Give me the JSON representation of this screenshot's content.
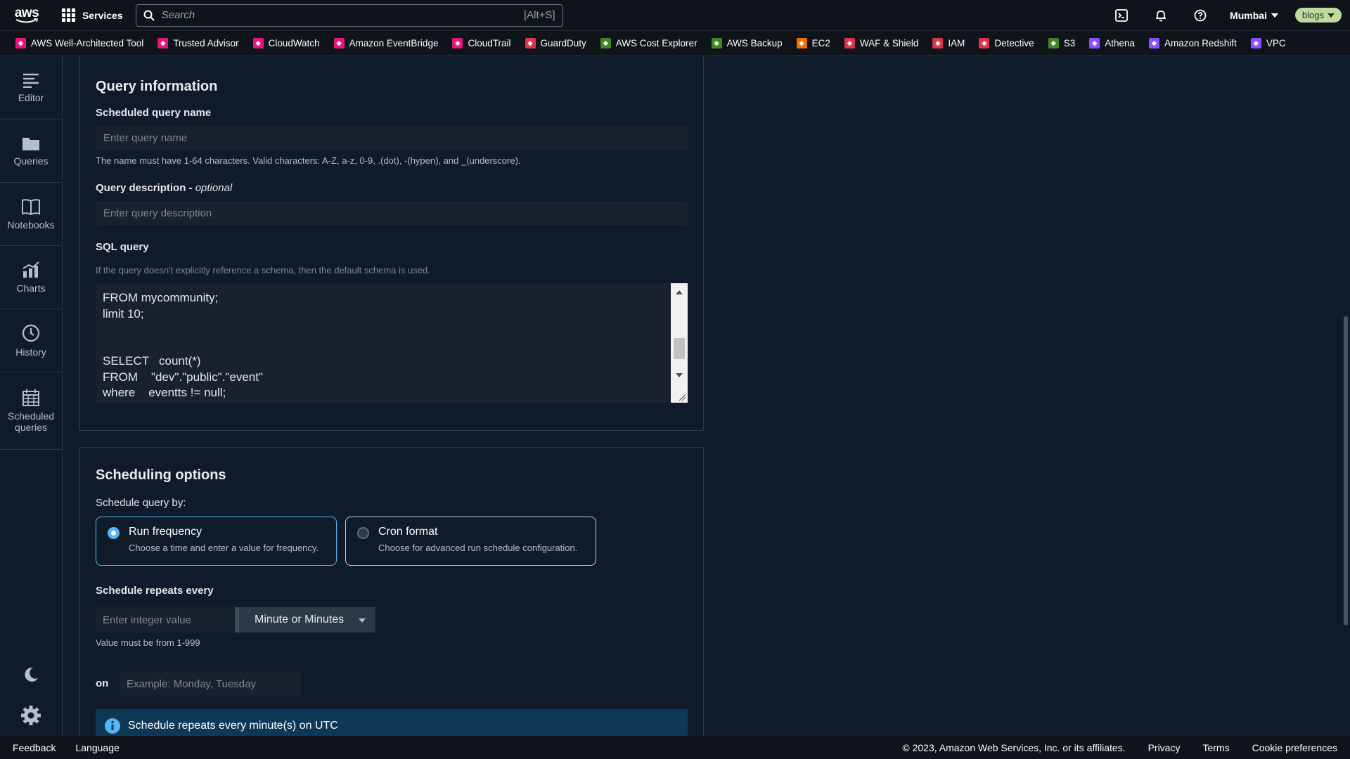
{
  "topnav": {
    "services_label": "Services",
    "search_placeholder": "Search",
    "search_shortcut": "[Alt+S]",
    "region": "Mumbai",
    "account": "blogs"
  },
  "favorites": [
    {
      "label": "AWS Well-Architected Tool",
      "color": "#e7157b"
    },
    {
      "label": "Trusted Advisor",
      "color": "#e7157b"
    },
    {
      "label": "CloudWatch",
      "color": "#e7157b"
    },
    {
      "label": "Amazon EventBridge",
      "color": "#e7157b"
    },
    {
      "label": "CloudTrail",
      "color": "#e7157b"
    },
    {
      "label": "GuardDuty",
      "color": "#dd344c"
    },
    {
      "label": "AWS Cost Explorer",
      "color": "#3f8624"
    },
    {
      "label": "AWS Backup",
      "color": "#3f8624"
    },
    {
      "label": "EC2",
      "color": "#ed7100"
    },
    {
      "label": "WAF & Shield",
      "color": "#dd344c"
    },
    {
      "label": "IAM",
      "color": "#dd344c"
    },
    {
      "label": "Detective",
      "color": "#dd344c"
    },
    {
      "label": "S3",
      "color": "#3f8624"
    },
    {
      "label": "Athena",
      "color": "#8c4fff"
    },
    {
      "label": "Amazon Redshift",
      "color": "#8c4fff"
    },
    {
      "label": "VPC",
      "color": "#8c4fff"
    }
  ],
  "rail": {
    "editor": "Editor",
    "queries": "Queries",
    "notebooks": "Notebooks",
    "charts": "Charts",
    "history": "History",
    "scheduled": "Scheduled queries"
  },
  "query_info": {
    "title": "Query information",
    "name_label": "Scheduled query name",
    "name_placeholder": "Enter query name",
    "name_hint": "The name must have 1-64 characters. Valid characters: A-Z, a-z, 0-9, .(dot), -(hypen), and _(underscore).",
    "desc_label": "Query description - ",
    "desc_optional": "optional",
    "desc_placeholder": "Enter query description",
    "sql_label": "SQL query",
    "sql_hint": "If the query doesn't explicitly reference a schema, then the default schema is used.",
    "sql_text": "FROM mycommunity;\nlimit 10;\n\n\nSELECT   count(*)\nFROM    \"dev\".\"public\".\"event\"\nwhere    eventts != null;"
  },
  "scheduling": {
    "title": "Scheduling options",
    "by_label": "Schedule query by:",
    "run_freq_title": "Run frequency",
    "run_freq_desc": "Choose a time and enter a value for frequency.",
    "cron_title": "Cron format",
    "cron_desc": "Choose for advanced run schedule configuration.",
    "repeats_label": "Schedule repeats every",
    "int_placeholder": "Enter integer value",
    "unit": "Minute or Minutes",
    "value_hint": "Value must be from 1-999",
    "on_label": "on",
    "on_placeholder": "Example: Monday, Tuesday",
    "info": "Schedule repeats every minute(s) on UTC"
  },
  "footer": {
    "feedback": "Feedback",
    "language": "Language",
    "copyright": "© 2023, Amazon Web Services, Inc. or its affiliates.",
    "privacy": "Privacy",
    "terms": "Terms",
    "cookies": "Cookie preferences"
  }
}
